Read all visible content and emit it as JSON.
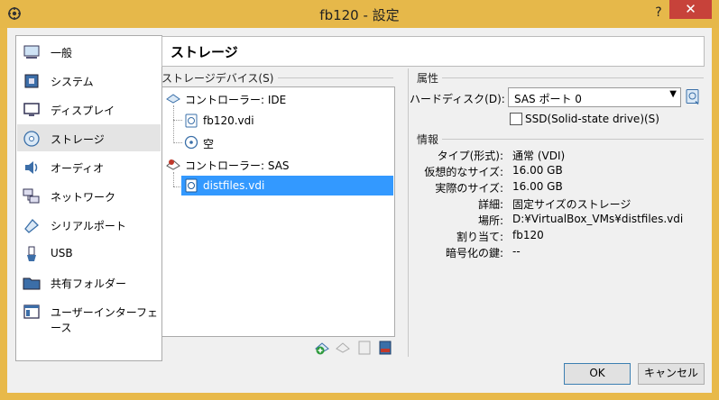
{
  "window": {
    "title": "fb120 - 設定",
    "help_glyph": "?",
    "close_glyph": "✕"
  },
  "sidebar": {
    "items": [
      {
        "label": "一般",
        "icon": "general-icon"
      },
      {
        "label": "システム",
        "icon": "system-icon"
      },
      {
        "label": "ディスプレイ",
        "icon": "display-icon"
      },
      {
        "label": "ストレージ",
        "icon": "storage-icon",
        "selected": true
      },
      {
        "label": "オーディオ",
        "icon": "audio-icon"
      },
      {
        "label": "ネットワーク",
        "icon": "network-icon"
      },
      {
        "label": "シリアルポート",
        "icon": "serial-port-icon"
      },
      {
        "label": "USB",
        "icon": "usb-icon"
      },
      {
        "label": "共有フォルダー",
        "icon": "shared-folder-icon"
      },
      {
        "label": "ユーザーインターフェース",
        "icon": "user-interface-icon"
      }
    ]
  },
  "header": {
    "title": "ストレージ"
  },
  "storage": {
    "section_label": "ストレージデバイス(S)",
    "tree": [
      {
        "label": "コントローラー: IDE",
        "type": "controller"
      },
      {
        "label": "fb120.vdi",
        "type": "disk"
      },
      {
        "label": "空",
        "type": "optical"
      },
      {
        "label": "コントローラー: SAS",
        "type": "controller"
      },
      {
        "label": "distfiles.vdi",
        "type": "disk",
        "selected": true
      }
    ]
  },
  "attributes": {
    "section_label": "属性",
    "hard_disk_label": "ハードディスク(D):",
    "hard_disk_value": "SAS ポート 0",
    "ssd_label": "SSD(Solid-state drive)(S)",
    "ssd_checked": false
  },
  "info": {
    "section_label": "情報",
    "rows": [
      {
        "label": "タイプ(形式):",
        "value": "通常 (VDI)"
      },
      {
        "label": "仮想的なサイズ:",
        "value": "16.00 GB"
      },
      {
        "label": "実際のサイズ:",
        "value": "16.00 GB"
      },
      {
        "label": "詳細:",
        "value": "固定サイズのストレージ"
      },
      {
        "label": "場所:",
        "value": "D:¥VirtualBox_VMs¥distfiles.vdi"
      },
      {
        "label": "割り当て:",
        "value": "fb120"
      },
      {
        "label": "暗号化の鍵:",
        "value": "--"
      }
    ]
  },
  "buttons": {
    "ok": "OK",
    "cancel": "キャンセル"
  },
  "colors": {
    "titlebar": "#e6b84a",
    "close": "#c7423a",
    "selection": "#3399ff"
  }
}
